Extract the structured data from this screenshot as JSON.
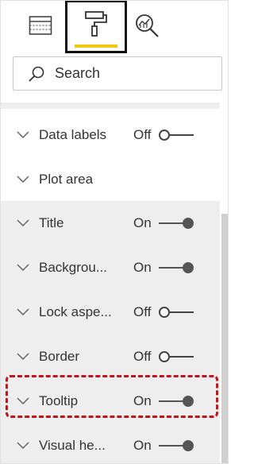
{
  "tabs": [
    {
      "icon": "fields-icon",
      "selected": false
    },
    {
      "icon": "paint-roller-icon",
      "selected": true
    },
    {
      "icon": "analytics-icon",
      "selected": false
    }
  ],
  "colors": {
    "selected_tab_underline": "#f2c811",
    "highlight_border": "#c0151a",
    "toggle_on": "#555555",
    "row_shade": "#eeeeee"
  },
  "search": {
    "placeholder": "Search"
  },
  "sections": [
    {
      "label": "Data labels",
      "state": "Off",
      "has_toggle": true
    },
    {
      "label": "Plot area",
      "state": "",
      "has_toggle": false
    },
    {
      "label": "Title",
      "state": "On",
      "has_toggle": true
    },
    {
      "label": "Backgrou...",
      "state": "On",
      "has_toggle": true
    },
    {
      "label": "Lock aspe...",
      "state": "Off",
      "has_toggle": true
    },
    {
      "label": "Border",
      "state": "Off",
      "has_toggle": true
    },
    {
      "label": "Tooltip",
      "state": "On",
      "has_toggle": true,
      "highlighted": true
    },
    {
      "label": "Visual he...",
      "state": "On",
      "has_toggle": true
    }
  ]
}
